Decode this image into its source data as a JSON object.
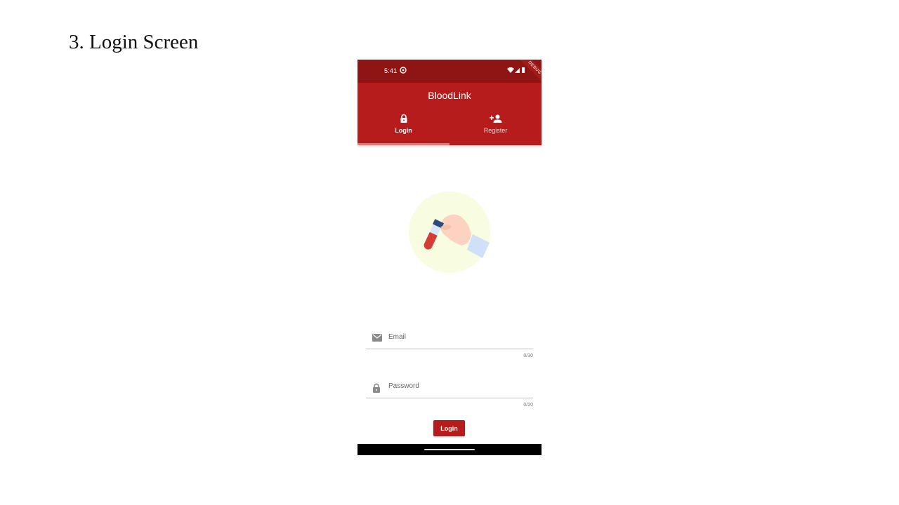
{
  "slide": {
    "title": "3. Login Screen"
  },
  "status_bar": {
    "time": "5:41",
    "debug_label": "DEBUG"
  },
  "app_bar": {
    "title": "BloodLink"
  },
  "tabs": [
    {
      "label": "Login",
      "icon": "lock-icon",
      "selected": true
    },
    {
      "label": "Register",
      "icon": "person-add-icon",
      "selected": false
    }
  ],
  "form": {
    "email": {
      "placeholder": "Email",
      "value": "",
      "counter": "0/30",
      "icon": "email-icon"
    },
    "password": {
      "placeholder": "Password",
      "value": "",
      "counter": "0/20",
      "icon": "lock-icon"
    },
    "login_button": "Login"
  },
  "colors": {
    "primary": "#b71c1c",
    "status_bar": "#8f1515",
    "illustration_bg": "#f8fce0"
  }
}
